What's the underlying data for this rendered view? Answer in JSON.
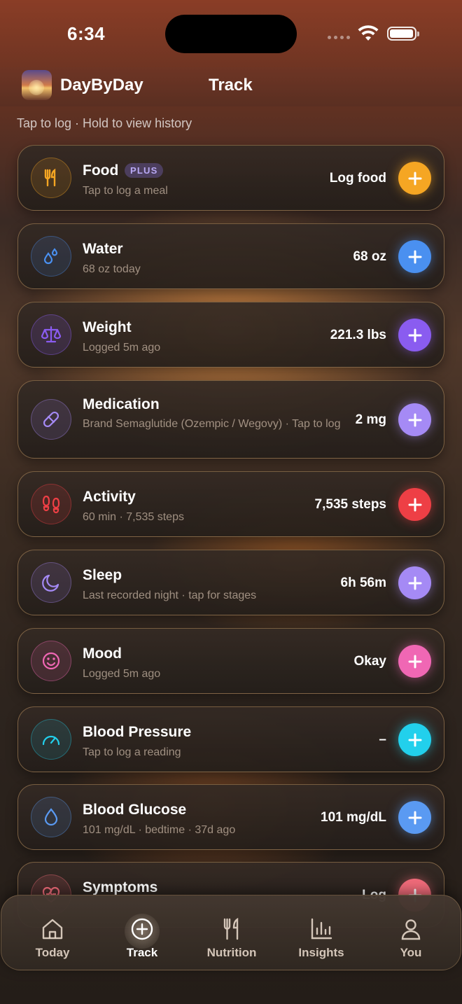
{
  "status": {
    "time": "6:34"
  },
  "header": {
    "app_name": "DayByDay",
    "title": "Track"
  },
  "hint": "Tap to log · Hold to view history",
  "cards": {
    "food": {
      "title": "Food",
      "badge": "PLUS",
      "subtitle": "Tap to log a meal",
      "value": "Log food",
      "color": "#f5a623"
    },
    "water": {
      "title": "Water",
      "subtitle": "68 oz today",
      "value": "68 oz",
      "color": "#4a90f0"
    },
    "weight": {
      "title": "Weight",
      "subtitle": "Logged 5m ago",
      "value": "221.3 lbs",
      "color": "#8a5cf0"
    },
    "medication": {
      "title": "Medication",
      "subtitle": "Brand Semaglutide (Ozempic / Wegovy) · Tap to log",
      "value": "2 mg",
      "color": "#a58af5"
    },
    "activity": {
      "title": "Activity",
      "subtitle": "60 min · 7,535 steps",
      "value": "7,535 steps",
      "color": "#ee3f45"
    },
    "sleep": {
      "title": "Sleep",
      "subtitle": "Last recorded night · tap for stages",
      "value": "6h 56m",
      "color": "#a58af5"
    },
    "mood": {
      "title": "Mood",
      "subtitle": "Logged 5m ago",
      "value": "Okay",
      "color": "#f067b4"
    },
    "blood_pressure": {
      "title": "Blood Pressure",
      "subtitle": "Tap to log a reading",
      "value": "–",
      "color": "#22d0ec"
    },
    "blood_glucose": {
      "title": "Blood Glucose",
      "subtitle": "101 mg/dL · bedtime · 37d ago",
      "value": "101 mg/dL",
      "color": "#5a9af2"
    },
    "symptoms": {
      "title": "Symptoms",
      "value": "Log",
      "color": "#f06b7a"
    }
  },
  "tabs": {
    "today": "Today",
    "track": "Track",
    "nutrition": "Nutrition",
    "insights": "Insights",
    "you": "You"
  }
}
